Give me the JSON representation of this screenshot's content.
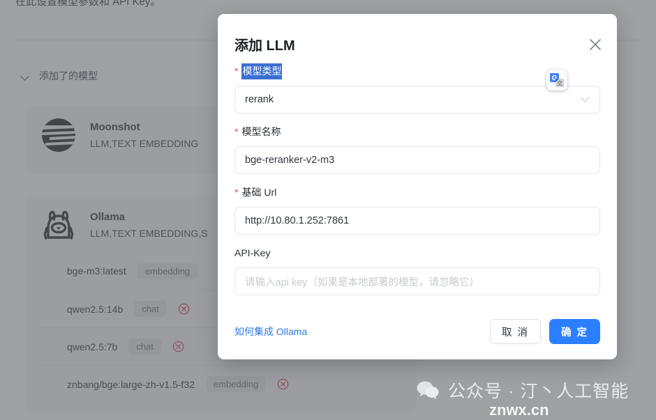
{
  "background": {
    "top_note": "在此设置模型参数和 API Key。",
    "section_title": "添加了的模型",
    "chevron_icon": "chevron-down-icon",
    "providers": [
      {
        "name": "Moonshot",
        "logo_icon": "moonshot-logo-icon",
        "types": "LLM,TEXT EMBEDDING",
        "models": []
      },
      {
        "name": "Ollama",
        "logo_icon": "ollama-llama-icon",
        "types": "LLM,TEXT EMBEDDING,S",
        "models": [
          {
            "name": "bge-m3:latest",
            "tag": "embedding",
            "delete_icon": "delete-circle-icon",
            "has_delete": false
          },
          {
            "name": "qwen2.5:14b",
            "tag": "chat",
            "delete_icon": "delete-circle-icon",
            "has_delete": true
          },
          {
            "name": "qwen2.5:7b",
            "tag": "chat",
            "delete_icon": "delete-circle-icon",
            "has_delete": true
          },
          {
            "name": "znbang/bge:large-zh-v1.5-f32",
            "tag": "embedding",
            "delete_icon": "delete-circle-icon",
            "has_delete": true
          }
        ]
      }
    ]
  },
  "modal": {
    "title": "添加 LLM",
    "close_icon": "close-icon",
    "fields": {
      "model_type": {
        "label": "模型类型",
        "required": true,
        "value": "rerank",
        "caret_icon": "chevron-down-icon"
      },
      "model_name": {
        "label": "模型名称",
        "required": true,
        "value": "bge-reranker-v2-m3"
      },
      "base_url": {
        "label": "基础 Url",
        "required": true,
        "value": "http://10.80.1.252:7861"
      },
      "api_key": {
        "label": "API-Key",
        "required": false,
        "value": "",
        "placeholder": "请输入api key（如果是本地部署的模型，请忽略它）"
      }
    },
    "help_link": "如何集成 Ollama",
    "cancel_label": "取 消",
    "confirm_label": "确 定"
  },
  "browser_extension": {
    "badge_icon": "google-translate-icon"
  },
  "watermark": {
    "wechat_icon": "wechat-icon",
    "text": "公众号 · 汀丶人工智能",
    "url": "znwx.cn"
  },
  "colors": {
    "primary": "#2b7fff",
    "link": "#2f7ae5",
    "danger": "#d9363e",
    "selection": "#3b6fd4",
    "required_star": "#e8514c"
  }
}
